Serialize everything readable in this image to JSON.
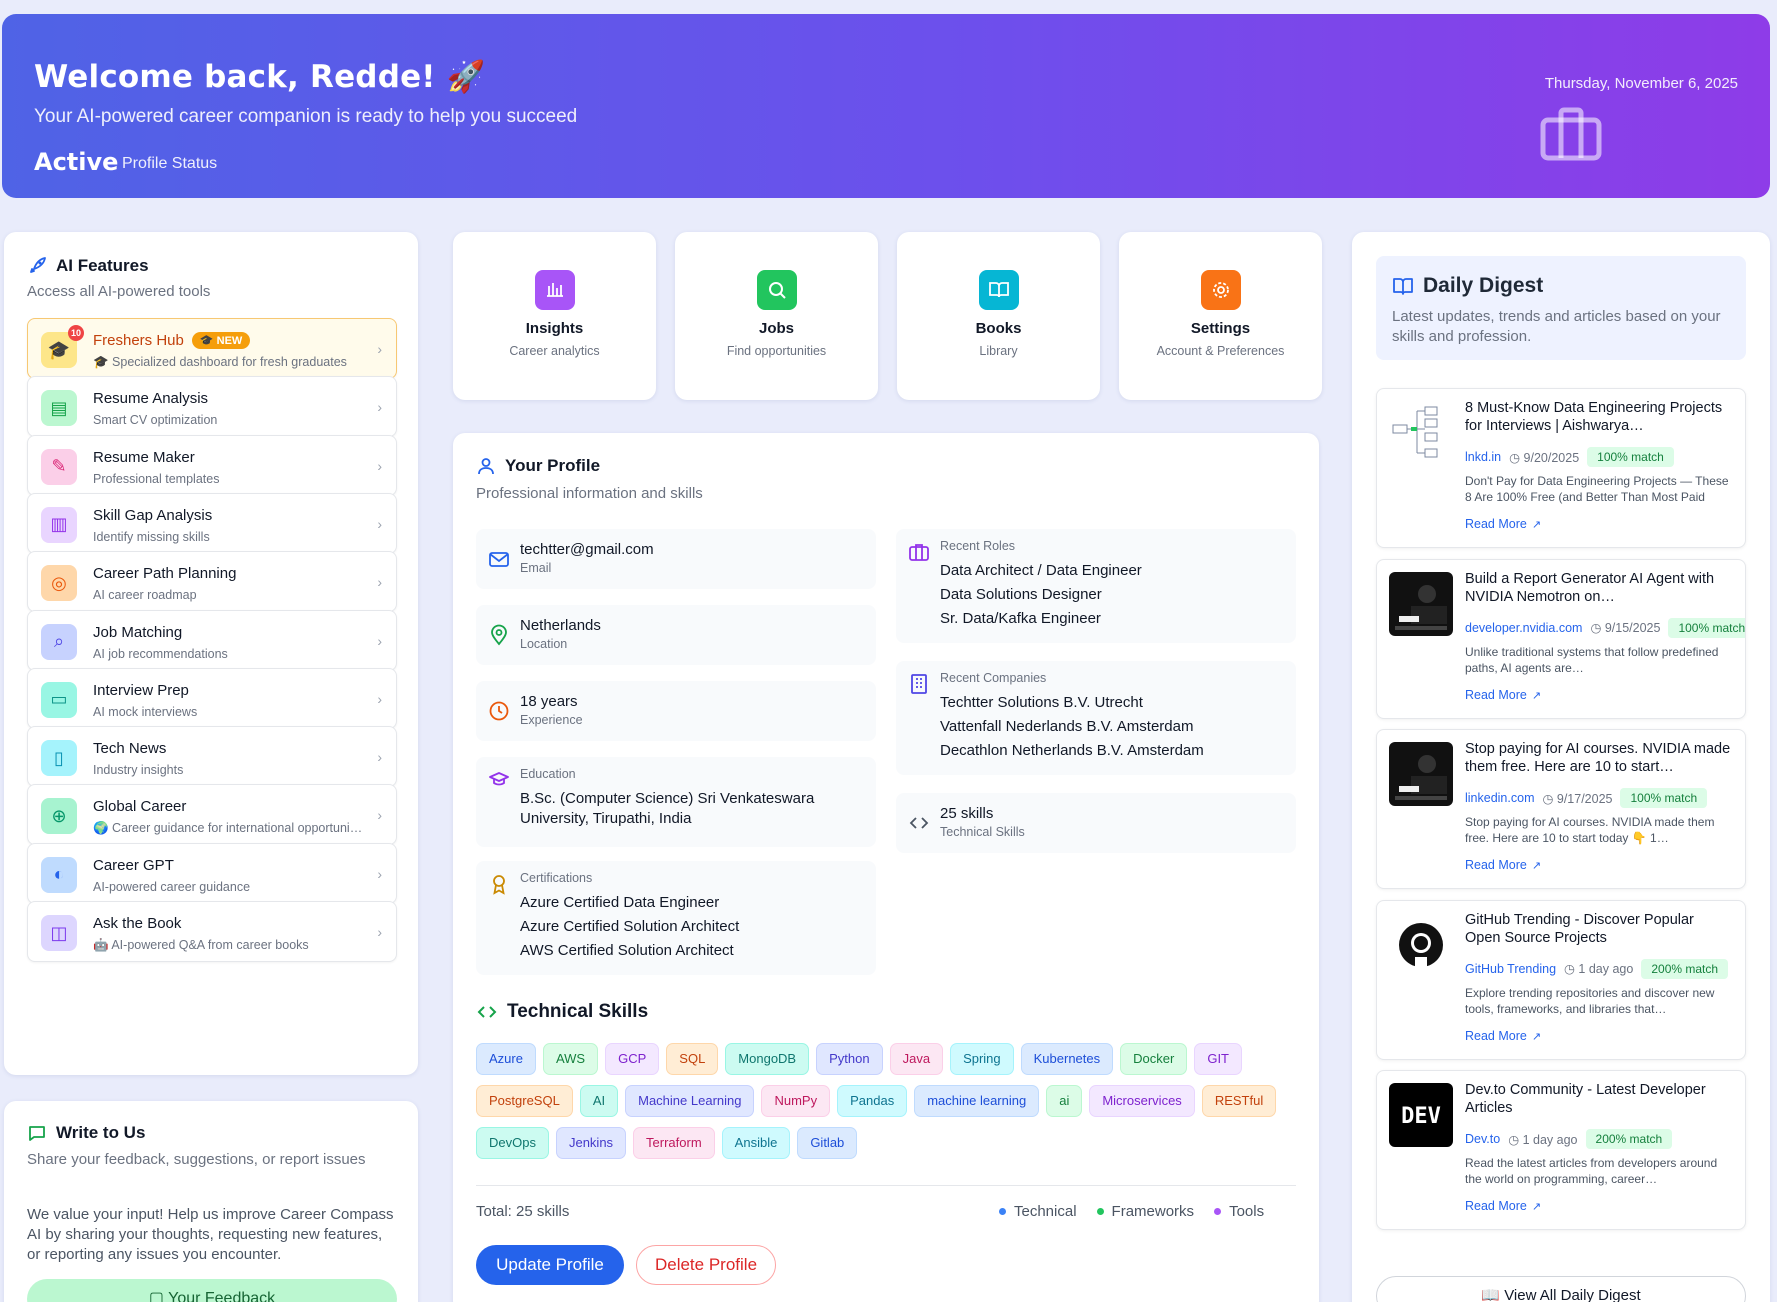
{
  "hero": {
    "title": "Welcome back, Redde! 🚀",
    "subtitle": "Your AI-powered career companion is ready to help you succeed",
    "status_value": "Active",
    "status_label": "Profile Status",
    "date": "Thursday, November 6, 2025"
  },
  "features": {
    "title": "AI Features",
    "subtitle": "Access all AI-powered tools",
    "items": [
      {
        "label": "Freshers Hub",
        "badge": "🎓 NEW",
        "notif": "10",
        "desc": "🎓 Specialized dashboard for fresh graduates",
        "icon": "graduation-cap-icon",
        "color": "#fde68a",
        "fg": "#a16207"
      },
      {
        "label": "Resume Analysis",
        "desc": "Smart CV optimization",
        "icon": "document-icon",
        "color": "#bbf7d0",
        "fg": "#16a34a"
      },
      {
        "label": "Resume Maker",
        "desc": "Professional templates",
        "icon": "pen-icon",
        "color": "#fbcfe8",
        "fg": "#db2777"
      },
      {
        "label": "Skill Gap Analysis",
        "desc": "Identify missing skills",
        "icon": "bar-chart-icon",
        "color": "#e9d5ff",
        "fg": "#9333ea"
      },
      {
        "label": "Career Path Planning",
        "desc": "AI career roadmap",
        "icon": "target-icon",
        "color": "#fed7aa",
        "fg": "#ea580c"
      },
      {
        "label": "Job Matching",
        "desc": "AI job recommendations",
        "icon": "search-icon",
        "color": "#c7d2fe",
        "fg": "#4f46e5"
      },
      {
        "label": "Interview Prep",
        "desc": "AI mock interviews",
        "icon": "chat-icon",
        "color": "#99f6e4",
        "fg": "#0d9488"
      },
      {
        "label": "Tech News",
        "desc": "Industry insights",
        "icon": "book-icon",
        "color": "#a5f3fc",
        "fg": "#0891b2"
      },
      {
        "label": "Global Career",
        "desc": "🌍 Career guidance for international opportunities",
        "icon": "globe-icon",
        "color": "#a7f3d0",
        "fg": "#059669"
      },
      {
        "label": "Career GPT",
        "desc": "AI-powered career guidance",
        "icon": "sparkle-icon",
        "color": "#bfdbfe",
        "fg": "#2563eb"
      },
      {
        "label": "Ask the Book",
        "desc": "🤖 AI-powered Q&A from career books",
        "icon": "open-book-icon",
        "color": "#ddd6fe",
        "fg": "#7c3aed"
      }
    ]
  },
  "write": {
    "title": "Write to Us",
    "subtitle": "Share your feedback, suggestions, or report issues",
    "body": "We value your input! Help us improve Career Compass AI by sharing your thoughts, requesting new features, or reporting any issues you encounter.",
    "button": "Your Feedback"
  },
  "quick": [
    {
      "title": "Insights",
      "sub": "Career analytics",
      "icon": "chart-icon",
      "color": "#a855f7"
    },
    {
      "title": "Jobs",
      "sub": "Find opportunities",
      "icon": "search-icon",
      "color": "#22c55e"
    },
    {
      "title": "Books",
      "sub": "Library",
      "icon": "book-icon",
      "color": "#06b6d4"
    },
    {
      "title": "Settings",
      "sub": "Account & Preferences",
      "icon": "gear-icon",
      "color": "#f97316"
    }
  ],
  "profile": {
    "title": "Your Profile",
    "subtitle": "Professional information and skills",
    "email": "techtter@gmail.com",
    "email_label": "Email",
    "location": "Netherlands",
    "location_label": "Location",
    "experience": "18 years",
    "experience_label": "Experience",
    "education_label": "Education",
    "education": "B.Sc. (Computer Science) Sri Venkateswara University, Tirupathi, India",
    "cert_label": "Certifications",
    "certs": [
      "Azure Certified Data Engineer",
      "Azure Certified Solution Architect",
      "AWS Certified Solution Architect"
    ],
    "roles_label": "Recent Roles",
    "roles": [
      "Data Architect / Data Engineer",
      "Data Solutions Designer",
      "Sr. Data/Kafka Engineer"
    ],
    "companies_label": "Recent Companies",
    "companies": [
      "Techtter Solutions B.V. Utrecht",
      "Vattenfall Nederlands B.V. Amsterdam",
      "Decathlon Netherlands B.V. Amsterdam"
    ],
    "skills_count": "25 skills",
    "skills_count_label": "Technical Skills",
    "skills_title": "Technical Skills",
    "skills": [
      {
        "name": "Azure",
        "bg": "#dbeafe",
        "fg": "#1d4ed8",
        "bd": "#bfdbfe"
      },
      {
        "name": "AWS",
        "bg": "#dcfce7",
        "fg": "#15803d",
        "bd": "#bbf7d0"
      },
      {
        "name": "GCP",
        "bg": "#f3e8ff",
        "fg": "#7e22ce",
        "bd": "#e9d5ff"
      },
      {
        "name": "SQL",
        "bg": "#ffedd5",
        "fg": "#c2410c",
        "bd": "#fed7aa"
      },
      {
        "name": "MongoDB",
        "bg": "#ccfbf1",
        "fg": "#0f766e",
        "bd": "#99f6e4"
      },
      {
        "name": "Python",
        "bg": "#e0e7ff",
        "fg": "#4338ca",
        "bd": "#c7d2fe"
      },
      {
        "name": "Java",
        "bg": "#fce7f3",
        "fg": "#be185d",
        "bd": "#fbcfe8"
      },
      {
        "name": "Spring",
        "bg": "#cffafe",
        "fg": "#0e7490",
        "bd": "#a5f3fc"
      },
      {
        "name": "Kubernetes",
        "bg": "#dbeafe",
        "fg": "#1d4ed8",
        "bd": "#bfdbfe"
      },
      {
        "name": "Docker",
        "bg": "#dcfce7",
        "fg": "#15803d",
        "bd": "#bbf7d0"
      },
      {
        "name": "GIT",
        "bg": "#f3e8ff",
        "fg": "#7e22ce",
        "bd": "#e9d5ff"
      },
      {
        "name": "PostgreSQL",
        "bg": "#ffedd5",
        "fg": "#c2410c",
        "bd": "#fed7aa"
      },
      {
        "name": "AI",
        "bg": "#ccfbf1",
        "fg": "#0f766e",
        "bd": "#99f6e4"
      },
      {
        "name": "Machine Learning",
        "bg": "#e0e7ff",
        "fg": "#4338ca",
        "bd": "#c7d2fe"
      },
      {
        "name": "NumPy",
        "bg": "#fce7f3",
        "fg": "#be185d",
        "bd": "#fbcfe8"
      },
      {
        "name": "Pandas",
        "bg": "#cffafe",
        "fg": "#0e7490",
        "bd": "#a5f3fc"
      },
      {
        "name": "machine learning",
        "bg": "#dbeafe",
        "fg": "#1d4ed8",
        "bd": "#bfdbfe"
      },
      {
        "name": "ai",
        "bg": "#dcfce7",
        "fg": "#15803d",
        "bd": "#bbf7d0"
      },
      {
        "name": "Microservices",
        "bg": "#f3e8ff",
        "fg": "#7e22ce",
        "bd": "#e9d5ff"
      },
      {
        "name": "RESTful",
        "bg": "#ffedd5",
        "fg": "#c2410c",
        "bd": "#fed7aa"
      },
      {
        "name": "DevOps",
        "bg": "#ccfbf1",
        "fg": "#0f766e",
        "bd": "#99f6e4"
      },
      {
        "name": "Jenkins",
        "bg": "#e0e7ff",
        "fg": "#4338ca",
        "bd": "#c7d2fe"
      },
      {
        "name": "Terraform",
        "bg": "#fce7f3",
        "fg": "#be185d",
        "bd": "#fbcfe8"
      },
      {
        "name": "Ansible",
        "bg": "#cffafe",
        "fg": "#0e7490",
        "bd": "#a5f3fc"
      },
      {
        "name": "Gitlab",
        "bg": "#dbeafe",
        "fg": "#1d4ed8",
        "bd": "#bfdbfe"
      }
    ],
    "total": "Total: 25 skills",
    "legend": [
      {
        "label": "Technical",
        "color": "#3b82f6"
      },
      {
        "label": "Frameworks",
        "color": "#22c55e"
      },
      {
        "label": "Tools",
        "color": "#a855f7"
      }
    ],
    "update_btn": "Update Profile",
    "delete_btn": "Delete Profile"
  },
  "digest": {
    "title": "Daily Digest",
    "subtitle": "Latest updates, trends and articles based on your skills and profession.",
    "read_more": "Read More",
    "articles": [
      {
        "title": "8 Must-Know Data Engineering Projects for Interviews | Aishwarya…",
        "source": "lnkd.in",
        "date": "9/20/2025",
        "match": "100% match",
        "excerpt": "Don't Pay for Data Engineering Projects — These 8 Are 100% Free (and Better Than Most Paid Ones)…",
        "thumb": "diagram"
      },
      {
        "title": "Build a Report Generator AI Agent with NVIDIA Nemotron on…",
        "source": "developer.nvidia.com",
        "date": "9/15/2025",
        "match": "100% match",
        "excerpt": "Unlike traditional systems that follow predefined paths, AI agents are…",
        "thumb": "dark"
      },
      {
        "title": "Stop paying for AI courses. NVIDIA made them free. Here are 10 to start…",
        "source": "linkedin.com",
        "date": "9/17/2025",
        "match": "100% match",
        "excerpt": "Stop paying for AI courses. NVIDIA made them free. Here are 10 to start today 👇 1…",
        "thumb": "dark"
      },
      {
        "title": "GitHub Trending - Discover Popular Open Source Projects",
        "source": "GitHub Trending",
        "date": "1 day ago",
        "match": "200% match",
        "excerpt": "Explore trending repositories and discover new tools, frameworks, and libraries that…",
        "thumb": "github"
      },
      {
        "title": "Dev.to Community - Latest Developer Articles",
        "source": "Dev.to",
        "date": "1 day ago",
        "match": "200% match",
        "excerpt": "Read the latest articles from developers around the world on programming, career…",
        "thumb": "dev"
      }
    ],
    "view_all": "View All Daily Digest"
  }
}
